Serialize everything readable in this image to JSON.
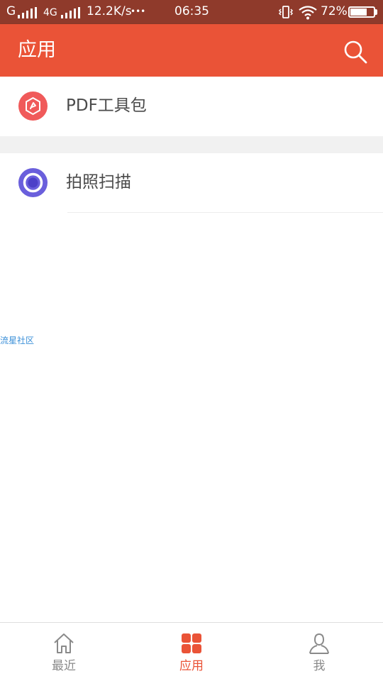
{
  "status_bar": {
    "carrier1": "G",
    "carrier2": "4G",
    "net_speed": "12.2K/s",
    "more_dots": "•••",
    "time": "06:35",
    "battery_pct": "72%",
    "battery_level": 0.72,
    "bg_color": "#8f3a2b"
  },
  "header": {
    "title": "应用",
    "search_icon": "search-icon",
    "bg_color": "#ea5337"
  },
  "apps": [
    {
      "label": "PDF工具包",
      "icon": "pdf-toolkit-icon",
      "icon_color": "#f05a5a"
    },
    {
      "label": "拍照扫描",
      "icon": "photo-scan-icon",
      "icon_color": "#6a5fdc"
    }
  ],
  "watermark": "流星社区",
  "bottom_nav": [
    {
      "label": "最近",
      "icon": "home-icon",
      "active": false
    },
    {
      "label": "应用",
      "icon": "apps-grid-icon",
      "active": true
    },
    {
      "label": "我",
      "icon": "person-icon",
      "active": false
    }
  ],
  "colors": {
    "accent": "#ea5337",
    "inactive": "#8a8a8a"
  }
}
